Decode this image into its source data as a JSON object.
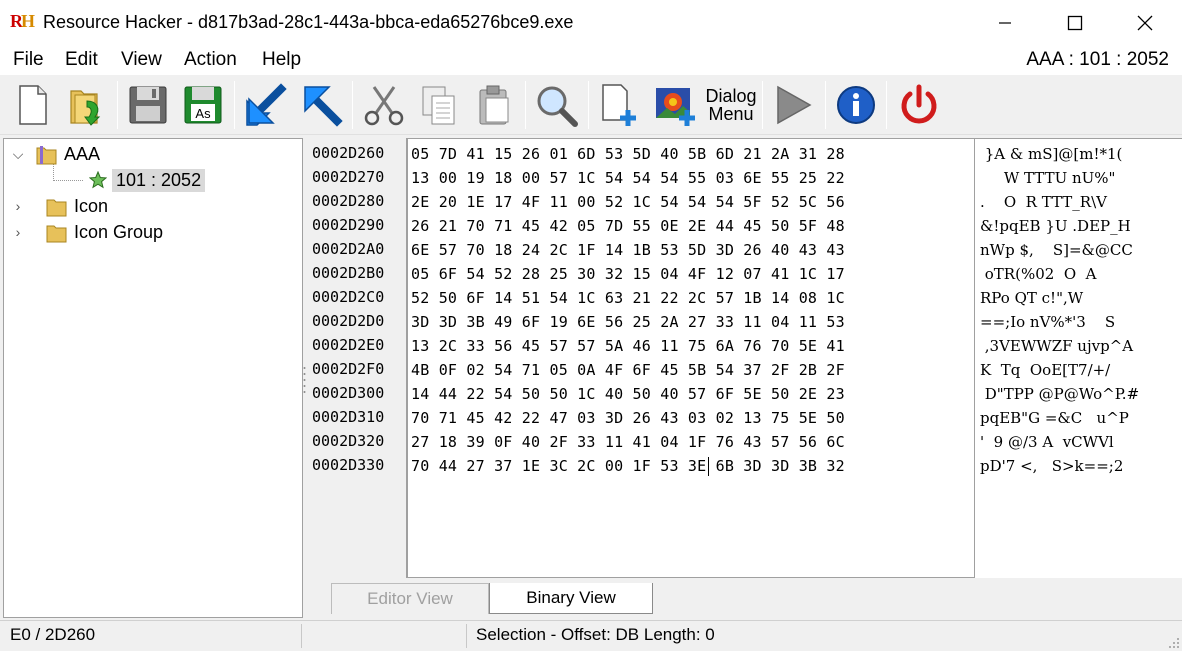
{
  "window": {
    "title": "Resource Hacker - d817b3ad-28c1-443a-bbca-eda65276bce9.exe",
    "logo_text": "RH"
  },
  "menu": {
    "items": [
      "File",
      "Edit",
      "View",
      "Action",
      "Help"
    ],
    "resource_id": "AAA : 101 : 2052"
  },
  "toolbar": {
    "dialog_menu_label_1": "Dialog",
    "dialog_menu_label_2": "Menu"
  },
  "tree": {
    "root_label": "AAA",
    "selected_label": "101 : 2052",
    "icon_label": "Icon",
    "icon_group_label": "Icon Group"
  },
  "hex": {
    "offsets": [
      "0002D260",
      "0002D270",
      "0002D280",
      "0002D290",
      "0002D2A0",
      "0002D2B0",
      "0002D2C0",
      "0002D2D0",
      "0002D2E0",
      "0002D2F0",
      "0002D300",
      "0002D310",
      "0002D320",
      "0002D330"
    ],
    "rows": [
      "05 7D 41 15 26 01 6D 53 5D 40 5B 6D 21 2A 31 28",
      "13 00 19 18 00 57 1C 54 54 54 55 03 6E 55 25 22",
      "2E 20 1E 17 4F 11 00 52 1C 54 54 54 5F 52 5C 56",
      "26 21 70 71 45 42 05 7D 55 0E 2E 44 45 50 5F 48",
      "6E 57 70 18 24 2C 1F 14 1B 53 5D 3D 26 40 43 43",
      "05 6F 54 52 28 25 30 32 15 04 4F 12 07 41 1C 17",
      "52 50 6F 14 51 54 1C 63 21 22 2C 57 1B 14 08 1C",
      "3D 3D 3B 49 6F 19 6E 56 25 2A 27 33 11 04 11 53",
      "13 2C 33 56 45 57 57 5A 46 11 75 6A 76 70 5E 41",
      "4B 0F 02 54 71 05 0A 4F 6F 45 5B 54 37 2F 2B 2F",
      "14 44 22 54 50 50 1C 40 50 40 57 6F 5E 50 2E 23",
      "70 71 45 42 22 47 03 3D 26 43 03 02 13 75 5E 50",
      "27 18 39 0F 40 2F 33 11 41 04 1F 76 43 57 56 6C",
      "70 44 27 37 1E 3C 2C 00 1F 53 3E 6B 3D 3D 3B 32"
    ],
    "ascii": [
      " }A & mS]@[m!*1(",
      "     W TTTU nU%\"",
      ".    O  R TTT_R\\V",
      "&!pqEB }U .DEP_H",
      "nWp $,    S]=&@CC",
      " oTR(%02  O  A",
      "RPo QT c!\",W",
      "==;Io nV%*'3    S",
      " ,3VEWWZF ujvp^A",
      "K  Tq  OoE[T7/+/",
      " D\"TPP @P@Wo^P.#",
      "pqEB\"G =&C   u^P",
      "'  9 @/3 A  vCWVl",
      "pD'7 <,   S>k==;2"
    ]
  },
  "tabs": {
    "editor_view": "Editor View",
    "binary_view": "Binary View"
  },
  "status": {
    "position": "E0 / 2D260",
    "selection": "Selection - Offset: DB Length: 0"
  }
}
